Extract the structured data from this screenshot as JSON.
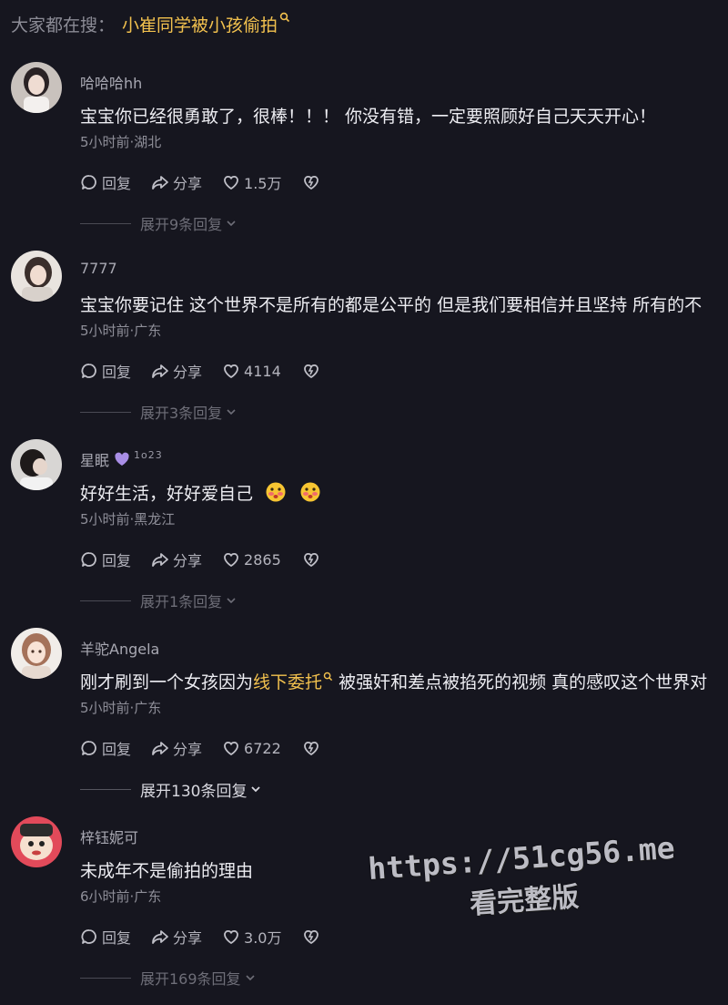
{
  "search": {
    "prefix": "大家都在搜：",
    "term": "小崔同学被小孩偷拍"
  },
  "comments": [
    {
      "username": "哈哈哈hh",
      "text": "宝宝你已经很勇敢了，很棒！！！ 你没有错，一定要照顾好自己天天开心！",
      "meta": "5小时前·湖北",
      "reply_label": "回复",
      "share_label": "分享",
      "likes": "1.5万",
      "expand": "展开9条回复"
    },
    {
      "username": "7777",
      "text": "宝宝你要记住 这个世界不是所有的都是公平的 但是我们要相信并且坚持 所有的不",
      "meta": "5小时前·广东",
      "reply_label": "回复",
      "share_label": "分享",
      "likes": "4114",
      "expand": "展开3条回复"
    },
    {
      "username": "星眠",
      "level": "1o23",
      "text": "好好生活，好好爱自己",
      "meta": "5小时前·黑龙江",
      "reply_label": "回复",
      "share_label": "分享",
      "likes": "2865",
      "expand": "展开1条回复"
    },
    {
      "username": "羊驼Angela",
      "text_before": "刚才刷到一个女孩因为",
      "keyword": "线下委托",
      "text_after": " 被强奸和差点被掐死的视频 真的感叹这个世界对",
      "meta": "5小时前·广东",
      "reply_label": "回复",
      "share_label": "分享",
      "likes": "6722",
      "expand": "展开130条回复"
    },
    {
      "username": "梓钰妮可",
      "text": "未成年不是偷拍的理由",
      "meta": "6小时前·广东",
      "reply_label": "回复",
      "share_label": "分享",
      "likes": "3.0万",
      "expand": "展开169条回复"
    }
  ],
  "watermark": {
    "url": "https://51cg56.me",
    "subtitle": "看完整版"
  },
  "colors": {
    "background": "#16161f",
    "keyword": "#f2c14e",
    "secondary_text": "#8e8e98"
  }
}
